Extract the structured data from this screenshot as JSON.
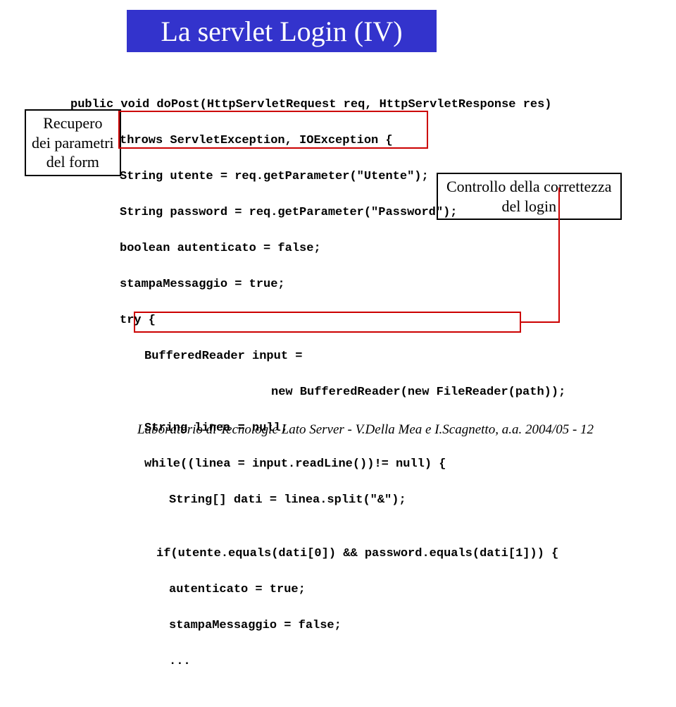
{
  "title": "La servlet Login (IV)",
  "annotations": {
    "left_line1": "Recupero",
    "left_line2": "dei parametri",
    "left_line3": "del form",
    "right_line1": "Controllo della correttezza",
    "right_line2": "del login"
  },
  "code": {
    "l1": "public void doPost(HttpServletRequest req, HttpServletResponse res)",
    "l2": "throws ServletException, IOException {",
    "l3": "String utente = req.getParameter(\"Utente\");",
    "l4": "String password = req.getParameter(\"Password\");",
    "l5": "boolean autenticato = false;",
    "l6": "stampaMessaggio = true;",
    "l7": "try {",
    "l8": "BufferedReader input =",
    "l9": "new BufferedReader(new FileReader(path));",
    "l10": "String linea = null;",
    "l11": "while((linea = input.readLine())!= null) {",
    "l12": "String[] dati = linea.split(\"&\");",
    "l13": "",
    "l14": "if(utente.equals(dati[0]) && password.equals(dati[1])) {",
    "l15": "autenticato = true;",
    "l16": "stampaMessaggio = false;",
    "l17": "..."
  },
  "footer": "Laboratorio di Tecnologie Lato Server - V.Della Mea e I.Scagnetto, a.a. 2004/05 - 12"
}
